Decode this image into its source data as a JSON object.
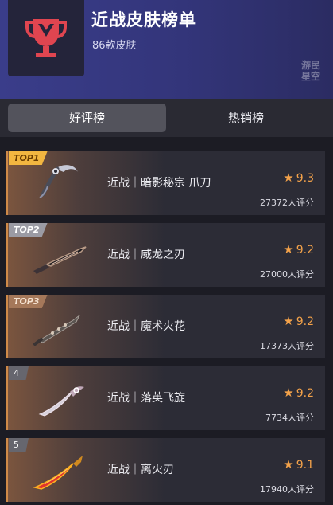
{
  "header": {
    "title": "近战皮肤榜单",
    "subtitle": "86款皮肤",
    "trophy_icon": "trophy-icon",
    "accent": "#e04550",
    "watermark": "游民星空"
  },
  "tabs": [
    {
      "label": "好评榜",
      "active": true
    },
    {
      "label": "热销榜",
      "active": false
    }
  ],
  "items": [
    {
      "badge": "TOP1",
      "name": "近战｜暗影秘宗 爪刀",
      "rating": "9.3",
      "count": "27372人评分",
      "icon": "karambit-knife-icon"
    },
    {
      "badge": "TOP2",
      "name": "近战｜威龙之刃",
      "rating": "9.2",
      "count": "27000人评分",
      "icon": "dragon-blade-icon"
    },
    {
      "badge": "TOP3",
      "name": "近战｜魔术火花",
      "rating": "9.2",
      "count": "17373人评分",
      "icon": "magic-spark-knife-icon"
    },
    {
      "badge": "4",
      "name": "近战｜落英飞旋",
      "rating": "9.2",
      "count": "7734人评分",
      "icon": "falling-blossom-knife-icon"
    },
    {
      "badge": "5",
      "name": "近战｜离火刃",
      "rating": "9.1",
      "count": "17940人评分",
      "icon": "fire-blade-icon"
    }
  ],
  "colors": {
    "rating": "#f3a24a",
    "top1": "#f2b640",
    "top2": "#9b9ba4",
    "top3": "#a5785a"
  }
}
